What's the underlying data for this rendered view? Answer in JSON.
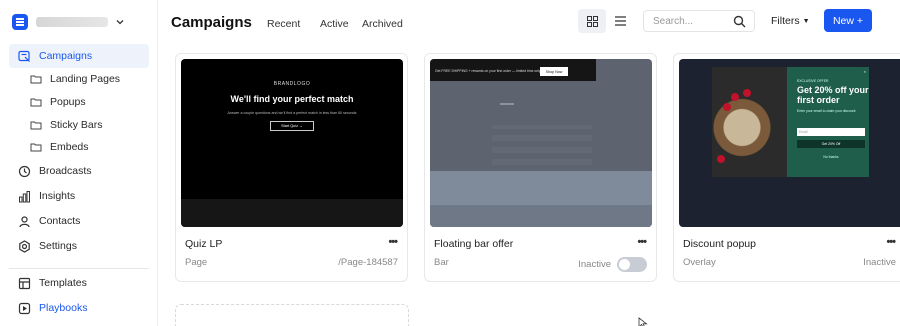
{
  "sidebar": {
    "items": [
      {
        "label": "Campaigns",
        "icon": "campaigns-icon"
      },
      {
        "label": "Landing Pages",
        "icon": "folder-icon"
      },
      {
        "label": "Popups",
        "icon": "folder-icon"
      },
      {
        "label": "Sticky Bars",
        "icon": "folder-icon"
      },
      {
        "label": "Embeds",
        "icon": "folder-icon"
      },
      {
        "label": "Broadcasts",
        "icon": "clock-icon"
      },
      {
        "label": "Insights",
        "icon": "bar-chart-icon"
      },
      {
        "label": "Contacts",
        "icon": "user-icon"
      },
      {
        "label": "Settings",
        "icon": "gear-icon"
      },
      {
        "label": "Templates",
        "icon": "template-icon"
      },
      {
        "label": "Playbooks",
        "icon": "play-icon"
      }
    ]
  },
  "header": {
    "title": "Campaigns",
    "tabs": [
      "Recent",
      "Active",
      "Archived"
    ],
    "search_placeholder": "Search...",
    "filters_label": "Filters",
    "new_label": "New +"
  },
  "cards": [
    {
      "name": "Quiz LP",
      "type": "Page",
      "meta": "/Page-184587",
      "thumb": {
        "logo": "BRANDLOGO",
        "headline": "We'll find your perfect match",
        "subtext": "Answer a couple questions and we'll find a perfect match in less than 60 seconds",
        "button": "Start Quiz →"
      }
    },
    {
      "name": "Floating bar offer",
      "type": "Bar",
      "meta": "Inactive",
      "thumb": {
        "bar_text": "Get FREE SHIPPING + rewards on your first order — limited time only",
        "bar_button": "Shop Now"
      }
    },
    {
      "name": "Discount popup",
      "type": "Overlay",
      "meta": "Inactive",
      "thumb": {
        "eyebrow": "EXCLUSIVE OFFER",
        "headline": "Get 20% off your first order",
        "subtext": "Enter your email to claim your discount",
        "input": "Email",
        "button": "Get 20% Off",
        "thanks": "No thanks",
        "close": "×"
      }
    }
  ],
  "colors": {
    "accent": "#1a56f0",
    "active_bg": "#eef3fb",
    "popup_green": "#1f5e4a"
  }
}
